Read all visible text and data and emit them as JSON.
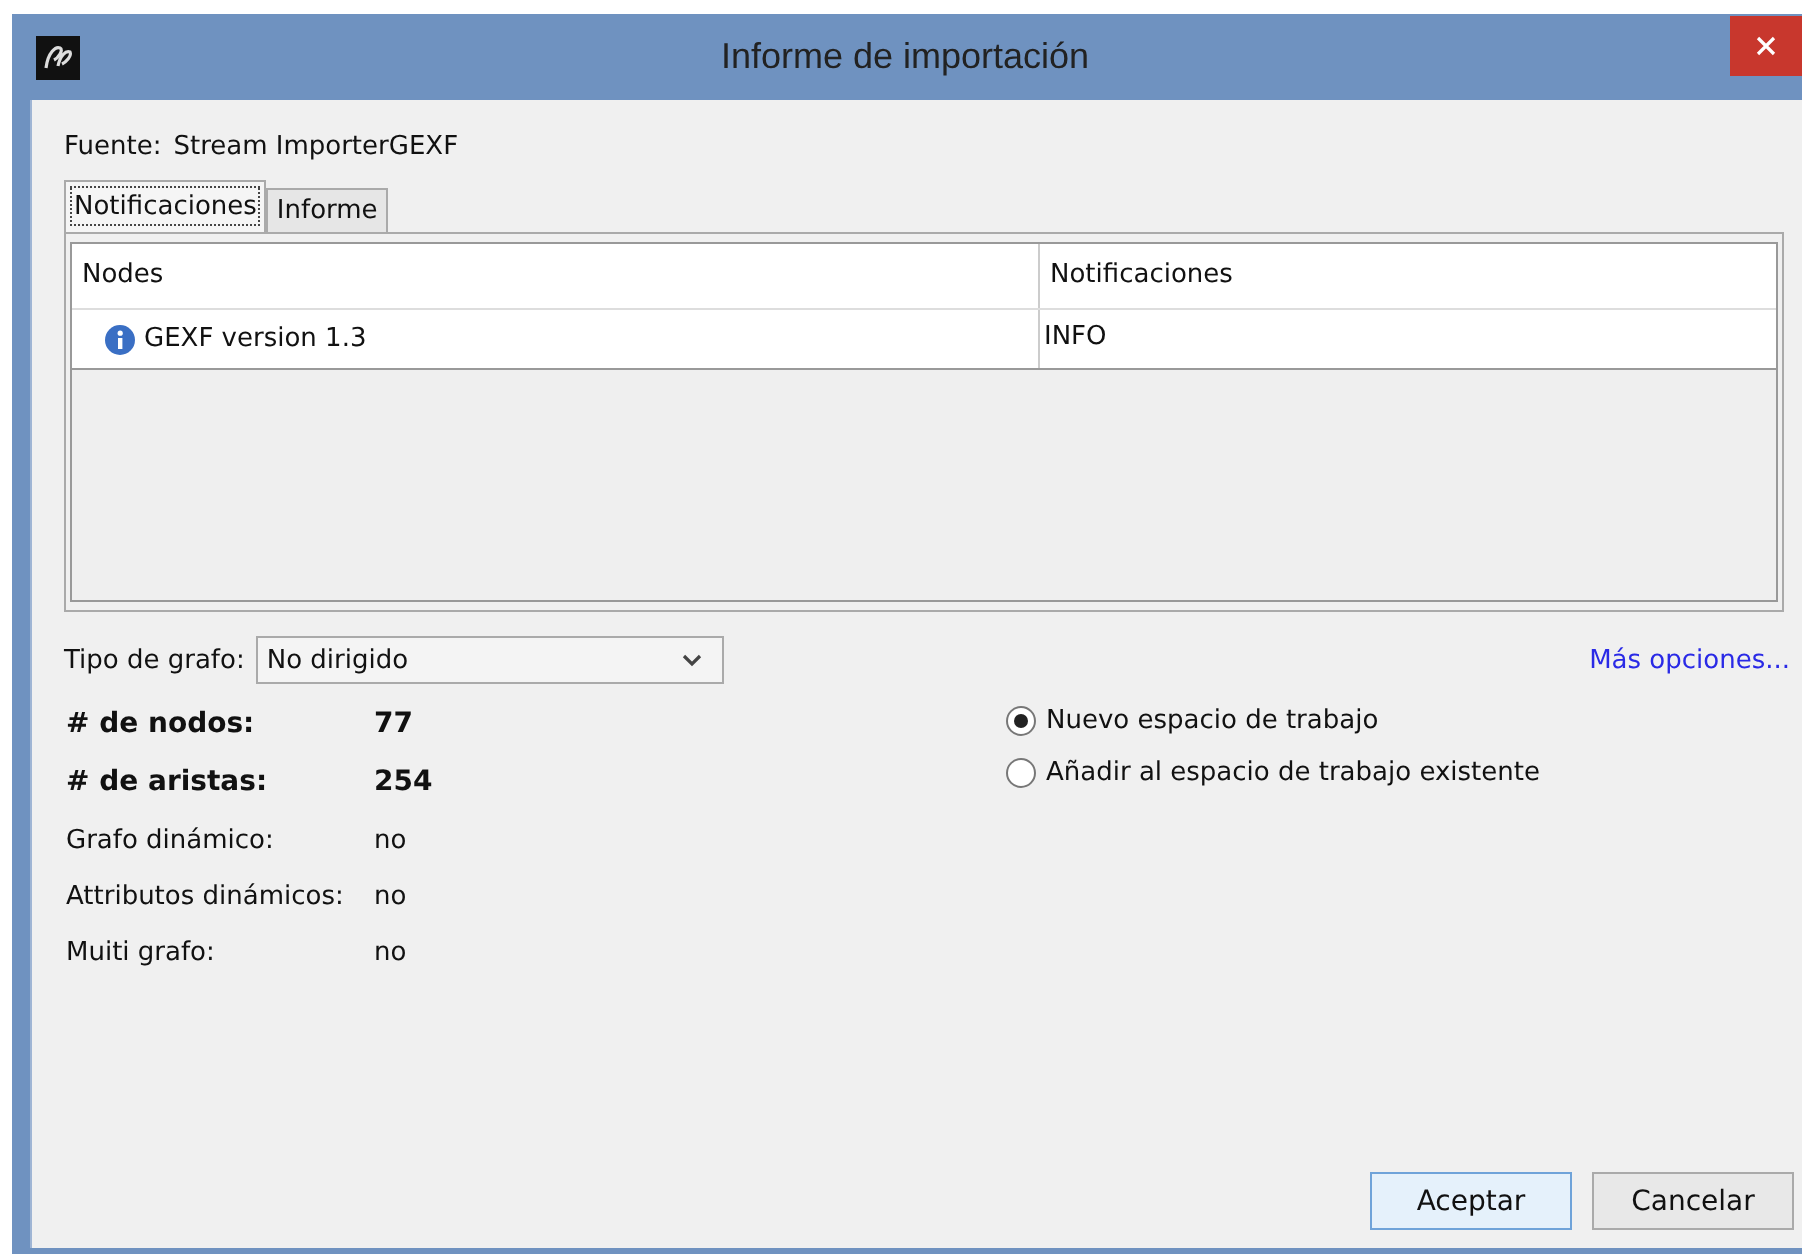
{
  "window": {
    "title": "Informe de importación"
  },
  "source": {
    "label": "Fuente:",
    "value": "Stream ImporterGEXF"
  },
  "tabs": [
    {
      "label": "Notificaciones",
      "selected": true
    },
    {
      "label": "Informe",
      "selected": false
    }
  ],
  "table": {
    "columns": [
      "Nodes",
      "Notificaciones"
    ],
    "rows": [
      {
        "kind": "info",
        "cells": [
          "GEXF version 1.3",
          "INFO"
        ]
      }
    ]
  },
  "graph_type": {
    "label": "Tipo de grafo:",
    "value": "No dirigido"
  },
  "more_options": "Más opciones...",
  "stats": [
    {
      "label": "# de nodos:",
      "value": "77",
      "bold": true
    },
    {
      "label": "# de aristas:",
      "value": "254",
      "bold": true
    },
    {
      "label": "Grafo dinámico:",
      "value": "no",
      "bold": false
    },
    {
      "label": "Attributos dinámicos:",
      "value": "no",
      "bold": false
    },
    {
      "label": "Muiti grafo:",
      "value": "no",
      "bold": false
    }
  ],
  "workspace_options": [
    {
      "label": "Nuevo espacio de trabajo",
      "selected": true
    },
    {
      "label": "Añadir al espacio de trabajo existente",
      "selected": false
    }
  ],
  "buttons": [
    {
      "label": "Aceptar",
      "default": true
    },
    {
      "label": "Cancelar",
      "default": false
    }
  ]
}
